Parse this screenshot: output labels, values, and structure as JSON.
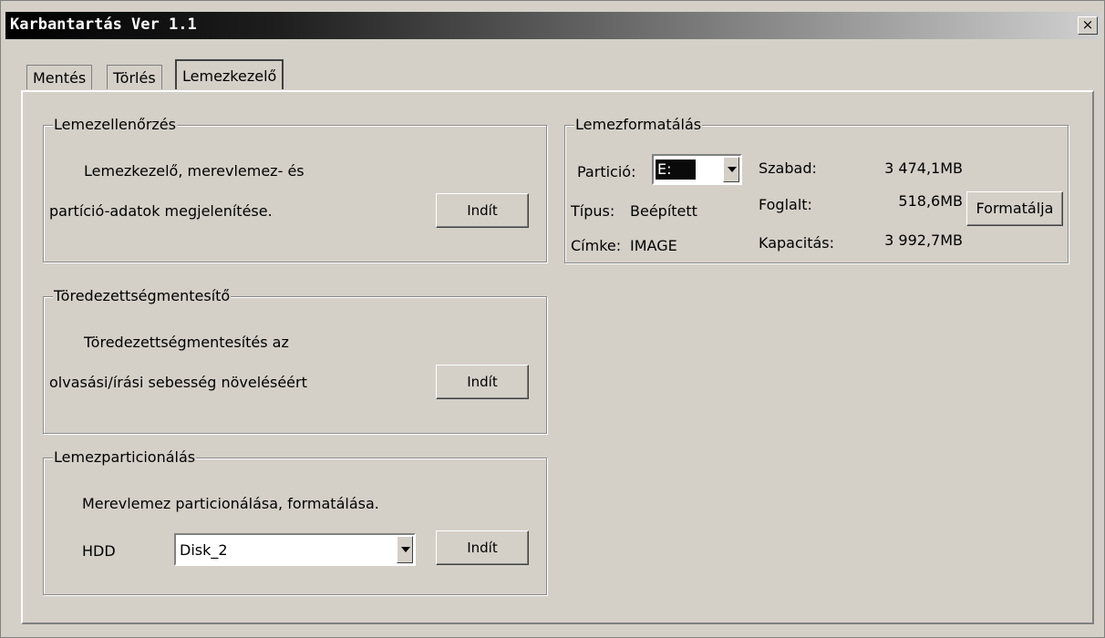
{
  "window": {
    "title": "Karbantartás Ver 1.1",
    "close_label": "×"
  },
  "tabs": [
    {
      "label": "Mentés"
    },
    {
      "label": "Törlés"
    },
    {
      "label": "Lemezkezelő"
    }
  ],
  "disk_check": {
    "legend": "Lemezellenőrzés",
    "line1": "Lemezkezelő, merevlemez- és",
    "line2": "partíció-adatok megjelenítése.",
    "button": "Indít"
  },
  "defrag": {
    "legend": "Töredezettségmentesítő",
    "line1": "Töredezettségmentesítés az",
    "line2": "olvasási/írási sebesség növeléséért",
    "button": "Indít"
  },
  "partitioning": {
    "legend": "Lemezparticionálás",
    "line1": "Merevlemez particionálása, formatálása.",
    "hdd_label": "HDD",
    "hdd_value": "Disk_2",
    "button": "Indít"
  },
  "format": {
    "legend": "Lemezformatálás",
    "partition_label": "Partició:",
    "partition_value": "E:",
    "type_label": "Típus:",
    "type_value": "Beépített",
    "volume_label": "Címke:",
    "volume_value": "IMAGE",
    "free_label": "Szabad:",
    "free_value": "3 474,1MB",
    "used_label": "Foglalt:",
    "used_value": "518,6MB",
    "capacity_label": "Kapacitás:",
    "capacity_value": "3 992,7MB",
    "button": "Formatálja"
  }
}
